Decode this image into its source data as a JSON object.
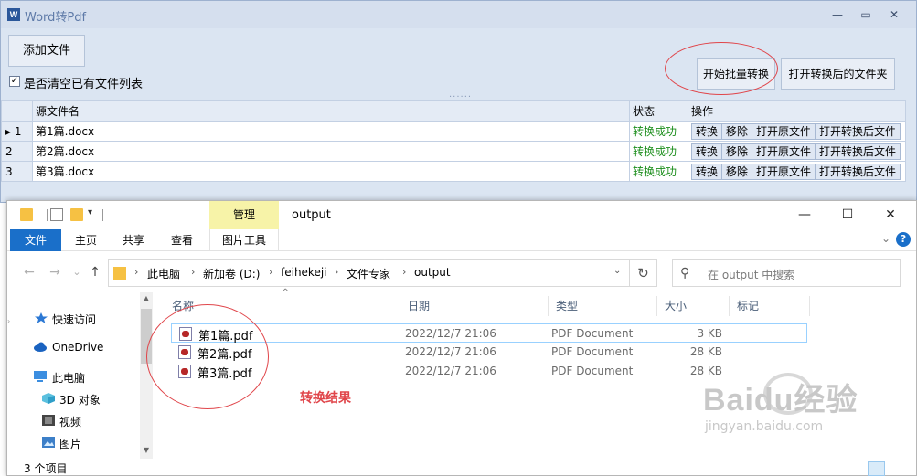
{
  "wordpdf": {
    "title": "Word转Pdf",
    "logo_letter": "W",
    "controls": [
      "—",
      "▭",
      "✕"
    ],
    "add_button": "添加文件",
    "checkbox_label": "是否清空已有文件列表",
    "checkbox_checked": "✓",
    "divider": "......",
    "start_button": "开始批量转换",
    "open_folder_button": "打开转换后的文件夹",
    "columns": {
      "name": "源文件名",
      "status": "状态",
      "actions": "操作"
    },
    "rows": [
      {
        "index": "1",
        "marker": "▸",
        "name": "第1篇.docx",
        "status": "转换成功"
      },
      {
        "index": "2",
        "marker": "",
        "name": "第2篇.docx",
        "status": "转换成功"
      },
      {
        "index": "3",
        "marker": "",
        "name": "第3篇.docx",
        "status": "转换成功"
      }
    ],
    "row_actions": [
      "转换",
      "移除",
      "打开原文件",
      "打开转换后文件"
    ]
  },
  "explorer": {
    "title": "output",
    "manage_tab": "管理",
    "ribbon_tabs": {
      "file": "文件",
      "home": "主页",
      "share": "共享",
      "view": "查看",
      "picture_tools": "图片工具"
    },
    "controls": [
      "—",
      "☐",
      "✕"
    ],
    "help": "?",
    "nav_icons": {
      "back": "←",
      "forward": "→",
      "recent": "⌄",
      "up": "↑",
      "refresh": "↻",
      "search": "⚲"
    },
    "address": [
      "此电脑",
      "新加卷 (D:)",
      "feihekeji",
      "文件专家",
      "output"
    ],
    "search_placeholder": "在 output 中搜索",
    "nav_items": [
      {
        "label": "快速访问",
        "icon": "star-icon"
      },
      {
        "label": "OneDrive",
        "icon": "cloud-icon"
      },
      {
        "label": "此电脑",
        "icon": "computer-icon"
      },
      {
        "label": "3D 对象",
        "icon": "cube-icon"
      },
      {
        "label": "视频",
        "icon": "video-icon"
      },
      {
        "label": "图片",
        "icon": "pictures-icon"
      }
    ],
    "columns": {
      "name": "名称",
      "date": "日期",
      "type": "类型",
      "size": "大小",
      "tags": "标记"
    },
    "files": [
      {
        "name": "第1篇.pdf",
        "date": "2022/12/7 21:06",
        "type": "PDF Document",
        "size": "3 KB"
      },
      {
        "name": "第2篇.pdf",
        "date": "2022/12/7 21:06",
        "type": "PDF Document",
        "size": "28 KB"
      },
      {
        "name": "第3篇.pdf",
        "date": "2022/12/7 21:06",
        "type": "PDF Document",
        "size": "28 KB"
      }
    ],
    "status": "3 个项目"
  },
  "annotation": {
    "result_label": "转换结果"
  },
  "watermark": {
    "brand": "Baidu经验",
    "url": "jingyan.baidu.com"
  },
  "colors": {
    "accent": "#1a6fc9",
    "success": "#1a8d1a",
    "annotation": "#e0454a",
    "manage_tab": "#f7f3a8"
  }
}
